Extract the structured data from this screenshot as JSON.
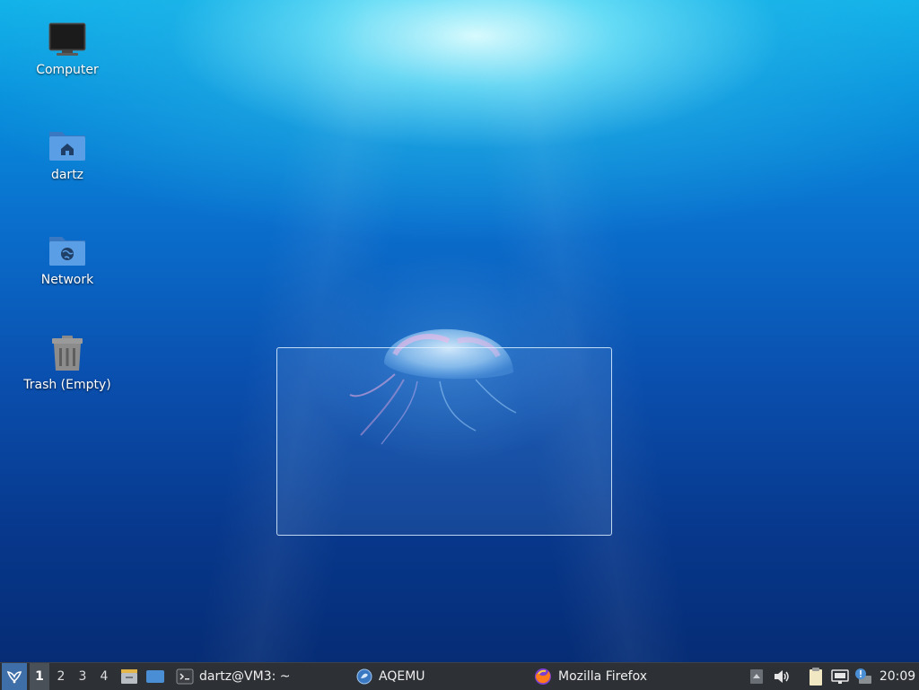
{
  "desktop": {
    "icons": [
      {
        "label": "Computer",
        "icon": "computer-icon"
      },
      {
        "label": "dartz",
        "icon": "home-folder-icon"
      },
      {
        "label": "Network",
        "icon": "network-folder-icon"
      },
      {
        "label": "Trash (Empty)",
        "icon": "trash-icon"
      }
    ]
  },
  "taskbar": {
    "menu_icon": "app-menu-icon",
    "workspaces": [
      "1",
      "2",
      "3",
      "4"
    ],
    "active_workspace": "1",
    "launchers": [
      "file-manager-icon",
      "show-desktop-icon"
    ],
    "tasks": [
      {
        "label": "dartz@VM3: ~",
        "icon": "terminal-icon"
      },
      {
        "label": "AQEMU",
        "icon": "aqemu-icon"
      },
      {
        "label": "Mozilla Firefox",
        "icon": "firefox-icon"
      }
    ],
    "tray": [
      "notification-arrow-icon",
      "volume-icon",
      "clipboard-icon",
      "network-icon",
      "update-icon"
    ],
    "clock": "20:09"
  },
  "colors": {
    "taskbar_bg": "#2d3136",
    "menu_button_bg": "#3f6fa8",
    "folder_blue": "#4a8fd6"
  }
}
